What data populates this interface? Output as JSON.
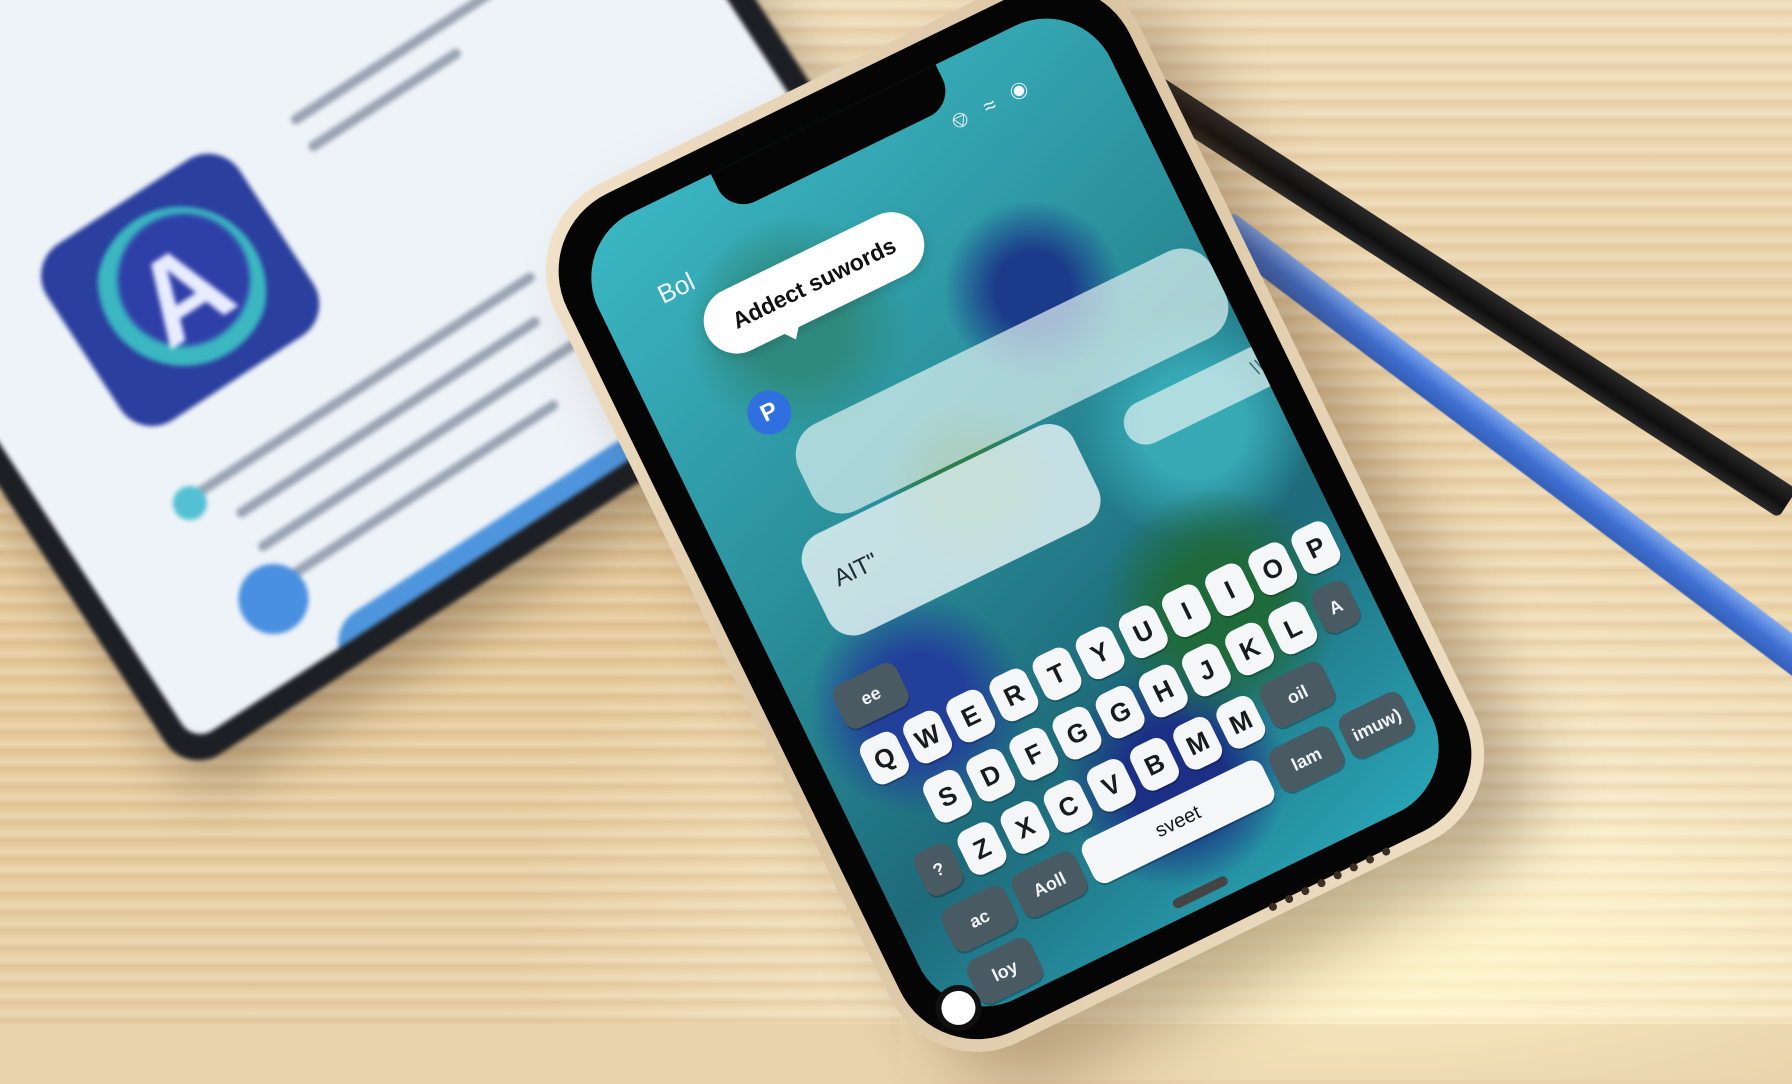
{
  "scene": {
    "desk_color": "#e9d3ac",
    "pencil_colors": [
      "#1a1a1a",
      "#3f70d2"
    ]
  },
  "tablet": {
    "logo_letter": "A",
    "logo_color": "#2a3f9e",
    "accent_color": "#3bb7c2",
    "button_label": ""
  },
  "phone": {
    "status_label": "Bol",
    "status_icons": [
      "bell-icon",
      "wifi-icon",
      "battery-icon"
    ],
    "bubble_text": "Addect suwords",
    "badge_letter": "P",
    "input_text": "AIT\"",
    "pill_text": "\\\\",
    "keyboard": {
      "row_top_dark": "ee",
      "row1": [
        "Q",
        "W",
        "E",
        "R",
        "T",
        "Y",
        "U",
        "I",
        "I",
        "O",
        "P"
      ],
      "row2": [
        "S",
        "D",
        "F",
        "G",
        "G",
        "H",
        "J",
        "K",
        "L"
      ],
      "row2_right_dark": "A",
      "row3": [
        "Z",
        "X",
        "C",
        "V",
        "B",
        "M",
        "M"
      ],
      "row3_left_dark": "?",
      "row3_right_dark": "oil",
      "row4_left_dark": "ac",
      "row4_right_dark_1": "lam",
      "row4_right_dark_2": "imuw)",
      "row5_left_dark": "loy",
      "row5_mid_dark": "Aoll",
      "space_label": "sveet"
    },
    "accent_color": "#2f6fe0"
  }
}
